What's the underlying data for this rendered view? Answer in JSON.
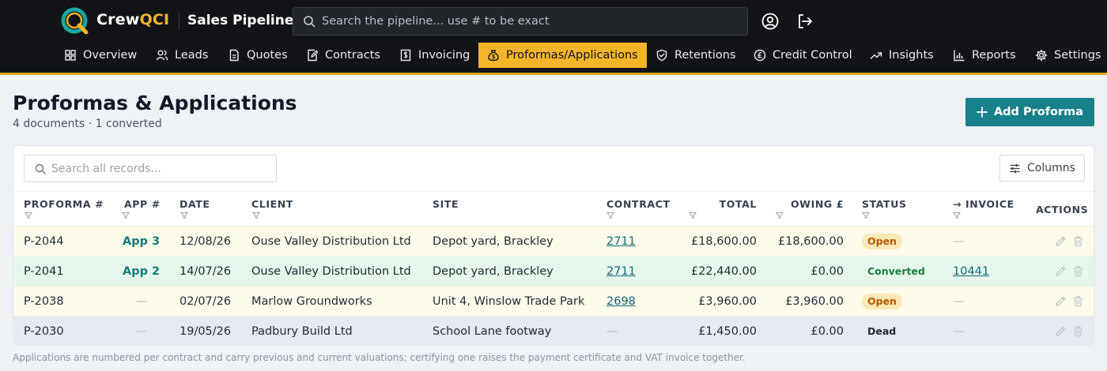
{
  "app": {
    "brand_part1": "Crew",
    "brand_part2": "QCI",
    "title": "Sales Pipeline",
    "search_placeholder": "Search the pipeline... use # to be exact",
    "accent_color": "#f5b529",
    "primary_color": "#16818a"
  },
  "nav": {
    "items": [
      {
        "label": "Overview",
        "icon": "grid-icon"
      },
      {
        "label": "Leads",
        "icon": "users-icon"
      },
      {
        "label": "Quotes",
        "icon": "document-icon"
      },
      {
        "label": "Contracts",
        "icon": "edit-document-icon"
      },
      {
        "label": "Invoicing",
        "icon": "invoice-icon"
      },
      {
        "label": "Proformas/Applications",
        "icon": "money-bag-icon",
        "active": true
      },
      {
        "label": "Retentions",
        "icon": "shield-icon"
      },
      {
        "label": "Credit Control",
        "icon": "pound-coin-icon"
      },
      {
        "label": "Insights",
        "icon": "trending-up-icon"
      },
      {
        "label": "Reports",
        "icon": "bar-chart-icon"
      },
      {
        "label": "Settings",
        "icon": "gear-icon"
      }
    ]
  },
  "page": {
    "title": "Proformas & Applications",
    "subtitle": "4 documents · 1 converted",
    "add_button": "Add Proforma"
  },
  "table": {
    "search_placeholder": "Search all records...",
    "columns_button": "Columns",
    "headers": {
      "proforma": "PROFORMA #",
      "app": "APP #",
      "date": "DATE",
      "client": "CLIENT",
      "site": "SITE",
      "contract": "CONTRACT",
      "total": "TOTAL",
      "owing": "OWING £",
      "status": "STATUS",
      "invoice": "→ INVOICE",
      "actions": "ACTIONS"
    },
    "rows": [
      {
        "proforma": "P-2044",
        "app": "App 3",
        "date": "12/08/26",
        "client": "Ouse Valley Distribution Ltd",
        "site": "Depot yard, Brackley",
        "contract": "2711",
        "total": "£18,600.00",
        "owing": "£18,600.00",
        "status": "Open",
        "invoice": "—"
      },
      {
        "proforma": "P-2041",
        "app": "App 2",
        "date": "14/07/26",
        "client": "Ouse Valley Distribution Ltd",
        "site": "Depot yard, Brackley",
        "contract": "2711",
        "total": "£22,440.00",
        "owing": "£0.00",
        "status": "Converted",
        "invoice": "10441"
      },
      {
        "proforma": "P-2038",
        "app": "—",
        "date": "02/07/26",
        "client": "Marlow Groundworks",
        "site": "Unit 4, Winslow Trade Park",
        "contract": "2698",
        "total": "£3,960.00",
        "owing": "£3,960.00",
        "status": "Open",
        "invoice": "—"
      },
      {
        "proforma": "P-2030",
        "app": "—",
        "date": "19/05/26",
        "client": "Padbury Build Ltd",
        "site": "School Lane footway",
        "contract": "—",
        "total": "£1,450.00",
        "owing": "£0.00",
        "status": "Dead",
        "invoice": "—"
      }
    ]
  },
  "footnote": "Applications are numbered per contract and carry previous and current valuations; certifying one raises the payment certificate and VAT invoice together."
}
